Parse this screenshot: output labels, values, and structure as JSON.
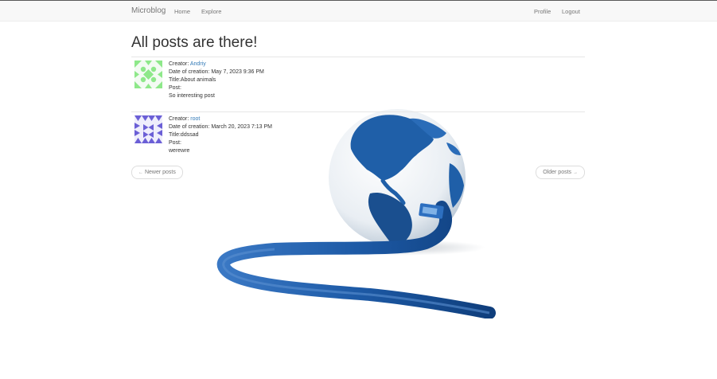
{
  "navbar": {
    "brand": "Microblog",
    "links": {
      "home": "Home",
      "explore": "Explore",
      "profile": "Profile",
      "logout": "Logout"
    }
  },
  "main": {
    "title": "All posts are there!",
    "posts": [
      {
        "creator_label": "Creator:",
        "creator": "Andriy",
        "date_label": "Date of creation:",
        "date": "May 7, 2023 9:36 PM",
        "title_label": "Title:",
        "title": "About animals",
        "post_label": "Post:",
        "body": "So interesting post",
        "avatar_color": "#8ee88a"
      },
      {
        "creator_label": "Creator:",
        "creator": "root",
        "date_label": "Date of creation:",
        "date": "March 20, 2023 7:13 PM",
        "title_label": "Title:",
        "title": "ddssad",
        "post_label": "Post:",
        "body": "werewre",
        "avatar_color": "#6b5fd6"
      }
    ],
    "pager": {
      "newer": "Newer posts",
      "older": "Older posts"
    }
  },
  "colors": {
    "link": "#337ab7",
    "navbar_bg": "#f8f8f8",
    "globe_blue": "#1f5fa8"
  }
}
